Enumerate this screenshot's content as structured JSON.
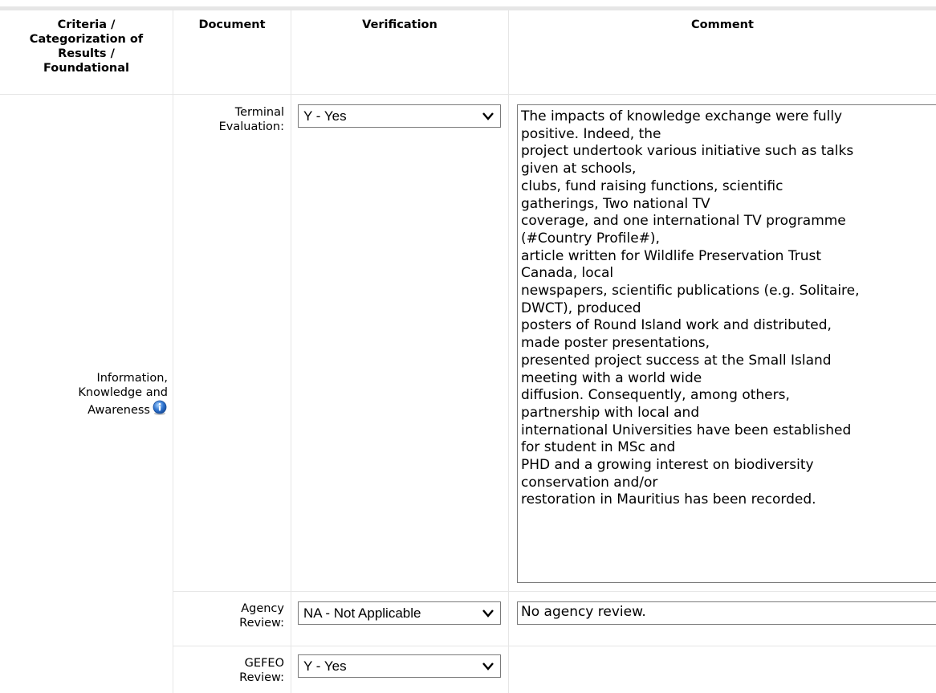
{
  "headers": {
    "criteria": [
      "Criteria /",
      "Categorization of",
      "Results /",
      "Foundational"
    ],
    "document": "Document",
    "verification": "Verification",
    "comment": "Comment"
  },
  "criterion": {
    "label_lines": [
      "Information,",
      "Knowledge and",
      "Awareness"
    ],
    "info_icon": "info-icon"
  },
  "rows": [
    {
      "document_lines": [
        "Terminal",
        "Evaluation:"
      ],
      "verification": "Y - Yes",
      "comment_lines": [
        "The impacts of knowledge exchange were fully",
        "positive. Indeed, the",
        "project undertook various initiative such as talks",
        "given at schools,",
        "clubs, fund raising functions, scientific",
        "gatherings, Two national TV",
        "coverage, and one international TV programme",
        "(#Country Profile#),",
        "article written for Wildlife Preservation Trust",
        "Canada, local",
        "newspapers, scientific publications (e.g. Solitaire,",
        "DWCT), produced",
        "posters of Round Island work and distributed,",
        "made poster presentations,",
        "presented project success at the Small Island",
        "meeting with a world wide",
        "diffusion. Consequently, among others,",
        "partnership with local and",
        "international Universities have been established",
        "for student in MSc and",
        "PHD and a growing interest on biodiversity",
        "conservation and/or",
        "restoration in Mauritius has been recorded."
      ]
    },
    {
      "document_lines": [
        "Agency",
        "Review:"
      ],
      "verification": "NA - Not Applicable",
      "comment_lines": [
        "No agency review."
      ]
    },
    {
      "document_lines": [
        "GEFEO",
        "Review:"
      ],
      "verification": "Y - Yes",
      "comment_lines": []
    }
  ],
  "colors": {
    "grid": "#e6e6e6",
    "field_border": "#7a7a7a",
    "icon_blue": "#2f74d0"
  }
}
